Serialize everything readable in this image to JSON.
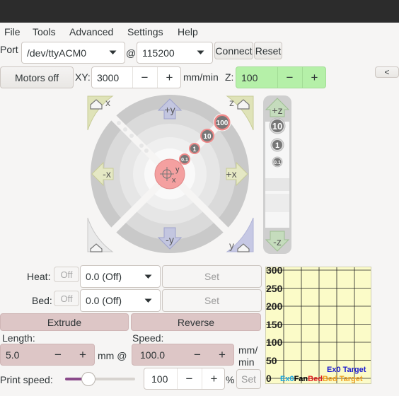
{
  "menu": [
    "File",
    "Tools",
    "Advanced",
    "Settings",
    "Help"
  ],
  "connection": {
    "port_label": "Port",
    "port_value": "/dev/ttyACM0",
    "at_label": "@",
    "baud_value": "115200",
    "connect_label": "Connect",
    "reset_label": "Reset"
  },
  "motion": {
    "motors_off_label": "Motors off",
    "xy_label": "XY:",
    "xy_speed": "3000",
    "unit_label": "mm/min",
    "z_label": "Z:",
    "z_speed": "100",
    "collapse_label": "<"
  },
  "jog": {
    "plus_y": "+y",
    "minus_y": "-y",
    "plus_x": "+x",
    "minus_x": "-x",
    "home_x": "x",
    "home_y": "y",
    "home_z": "z",
    "steps": [
      "100",
      "10",
      "1",
      "0.1"
    ],
    "center_y": "y",
    "center_x": "x"
  },
  "zjog": {
    "plus_z": "+z",
    "minus_z": "-z",
    "steps": [
      "10",
      "1",
      "0.1"
    ]
  },
  "temps": {
    "heat_label": "Heat:",
    "heat_toggle": "Off",
    "heat_value": "0.0 (Off)",
    "bed_label": "Bed:",
    "bed_toggle": "Off",
    "bed_value": "0.0 (Off)",
    "set_label": "Set"
  },
  "extrusion": {
    "extrude_label": "Extrude",
    "reverse_label": "Reverse",
    "length_label": "Length:",
    "length_value": "5.0",
    "mm_at_label": "mm @",
    "speed_label": "Speed:",
    "speed_value": "100.0",
    "speed_unit_1": "mm/",
    "speed_unit_2": "min"
  },
  "print_speed": {
    "label": "Print speed:",
    "slider_fraction": 0.33,
    "value": "100",
    "unit": "%",
    "set_label": "Set"
  },
  "graph": {
    "y_ticks": [
      "300",
      "250",
      "200",
      "150",
      "100",
      "50",
      "0"
    ],
    "legend_right": "Ex0 Target",
    "legend_bottom": [
      {
        "text": "Ex0",
        "color": "#19a7e0"
      },
      {
        "text": "Fan",
        "color": "#000000"
      },
      {
        "text": "Bed",
        "color": "#e02020"
      },
      {
        "text": "Bed Target",
        "color": "#f0a020"
      }
    ],
    "legend_right_color": "#1a1ad0",
    "background": "#fbfbc8"
  },
  "colors": {
    "accent_pink": "#ddc6c6",
    "z_field_green": "#b5f0a8",
    "jog_center": "#f4a0a0"
  }
}
